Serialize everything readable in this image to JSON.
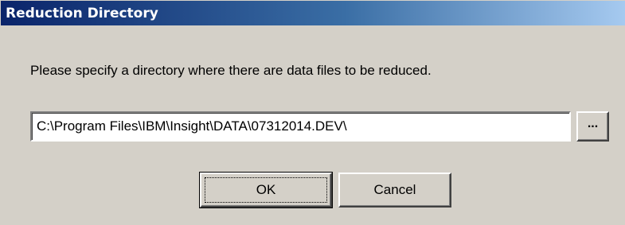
{
  "window": {
    "title": "Reduction Directory"
  },
  "content": {
    "prompt": "Please specify a directory where there are data files to be reduced."
  },
  "path_field": {
    "value": "C:\\Program Files\\IBM\\Insight\\DATA\\07312014.DEV\\"
  },
  "buttons": {
    "browse_label": "...",
    "ok_label": "OK",
    "cancel_label": "Cancel"
  },
  "colors": {
    "titlebar_start": "#0a246a",
    "titlebar_end": "#a6caf0",
    "dialog_bg": "#d4d0c8"
  }
}
